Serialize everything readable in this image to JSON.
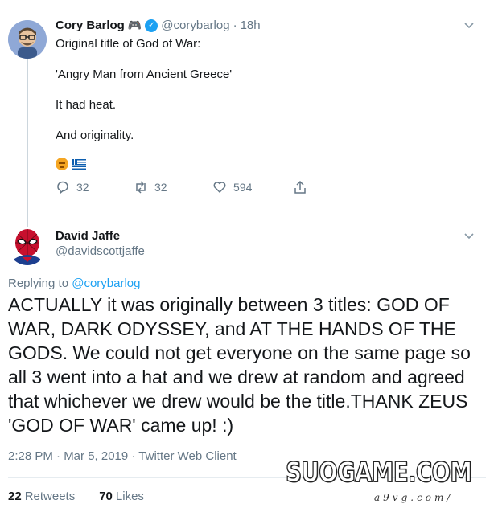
{
  "tweet1": {
    "display_name": "Cory Barlog",
    "name_emoji": "🎮",
    "handle": "@corybarlog",
    "separator": "·",
    "time": "18h",
    "lines": [
      "Original title of God of War:",
      "'Angry Man from Ancient Greece'",
      "It had heat.",
      "And originality."
    ],
    "emojis": [
      "angry-face",
      "greece-flag"
    ],
    "actions": {
      "replies": "32",
      "retweets": "32",
      "likes": "594"
    }
  },
  "tweet2": {
    "display_name": "David Jaffe",
    "handle": "@davidscottjaffe",
    "replying_prefix": "Replying to ",
    "replying_to": "@corybarlog",
    "body": "ACTUALLY it was originally between 3 titles: GOD OF WAR, DARK ODYSSEY, and AT THE HANDS OF THE GODS. We could not get everyone on the same page so all 3 went into a hat and we drew at random and agreed that whichever we drew would be the title.THANK ZEUS 'GOD OF WAR' came up! :)",
    "meta": "2:28 PM · Mar 5, 2019 · Twitter Web Client",
    "retweets_count": "22",
    "retweets_label": "Retweets",
    "likes_count": "70",
    "likes_label": "Likes"
  },
  "watermark": {
    "main": "SUOGAME.COM",
    "sub": "a9vg.com/"
  },
  "colors": {
    "accent": "#1da1f2",
    "muted": "#657786",
    "text": "#14171a"
  }
}
